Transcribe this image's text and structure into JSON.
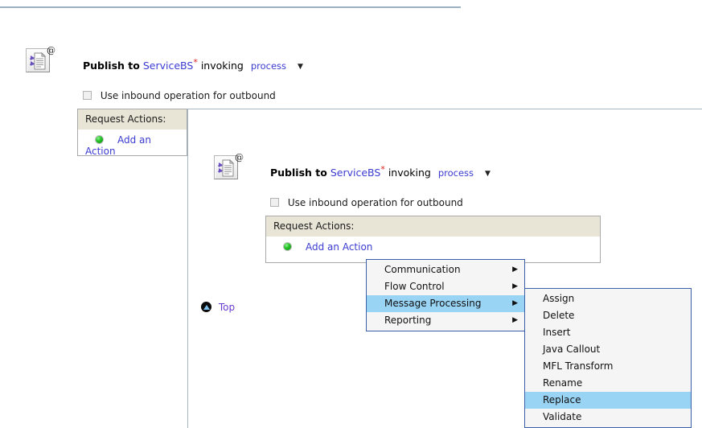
{
  "panels": {
    "background": {
      "title": {
        "publish_label": "Publish to",
        "service_link": "ServiceBS",
        "required_marker": "*",
        "invoking_label": "invoking",
        "operation": "process",
        "caret": "▼"
      },
      "checkbox": {
        "label": "Use inbound operation for outbound",
        "checked": false
      },
      "request_actions": {
        "header": "Request Actions:",
        "add_action_label": "Add an Action"
      },
      "icon": "publish-document-icon",
      "badge": "@"
    },
    "main": {
      "title": {
        "publish_label": "Publish to",
        "service_link": "ServiceBS",
        "required_marker": "*",
        "invoking_label": "invoking",
        "operation": "process",
        "caret": "▼"
      },
      "checkbox": {
        "label": "Use inbound operation for outbound",
        "checked": false
      },
      "request_actions": {
        "header": "Request Actions:",
        "add_action_label": "Add an Action"
      },
      "icon": "publish-document-icon",
      "badge": "@"
    }
  },
  "top_link": {
    "label": "Top",
    "icon": "up-arrow-circle-icon"
  },
  "context_menu": {
    "items": [
      {
        "label": "Communication",
        "has_submenu": true,
        "selected": false,
        "arrow": "▶"
      },
      {
        "label": "Flow Control",
        "has_submenu": true,
        "selected": false,
        "arrow": "▶"
      },
      {
        "label": "Message Processing",
        "has_submenu": true,
        "selected": true,
        "arrow": "▶"
      },
      {
        "label": "Reporting",
        "has_submenu": true,
        "selected": false,
        "arrow": "▶"
      }
    ]
  },
  "submenu": {
    "parent": "Message Processing",
    "items": [
      {
        "label": "Assign",
        "selected": false
      },
      {
        "label": "Delete",
        "selected": false
      },
      {
        "label": "Insert",
        "selected": false
      },
      {
        "label": "Java Callout",
        "selected": false
      },
      {
        "label": "MFL Transform",
        "selected": false
      },
      {
        "label": "Rename",
        "selected": false
      },
      {
        "label": "Replace",
        "selected": true
      },
      {
        "label": "Validate",
        "selected": false
      }
    ]
  },
  "colors": {
    "menu_border": "#3a5fa8",
    "menu_background": "#f5f5f5",
    "menu_highlight": "#9ad4f5",
    "panel_header": "#e8e5d7",
    "link": "#3b3bd1",
    "required_marker": "#dd2222",
    "rule": "#9bb0c0",
    "bullet_green": "#22c022"
  }
}
